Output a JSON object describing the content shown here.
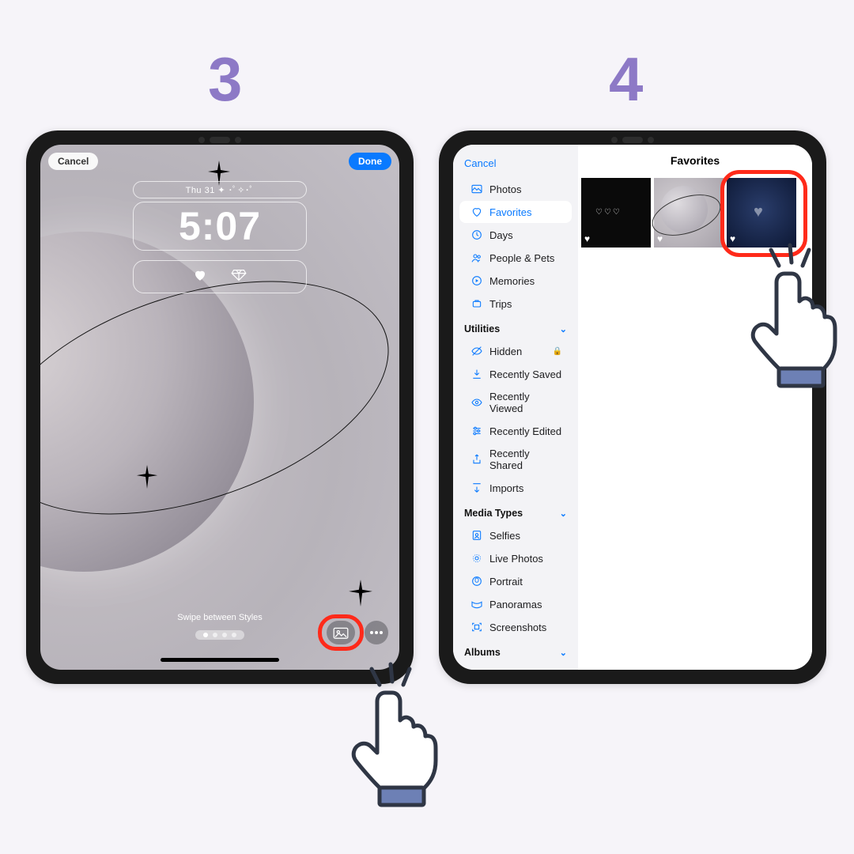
{
  "steps": {
    "s3": "3",
    "s4": "4"
  },
  "lock": {
    "cancel": "Cancel",
    "done": "Done",
    "date": "Thu 31  ✦ ･ﾟ✧･ﾟ",
    "time": "5:07",
    "swipe": "Swipe between Styles"
  },
  "picker": {
    "cancel": "Cancel",
    "title": "Favorites",
    "sections": {
      "utilities": "Utilities",
      "media": "Media Types",
      "albums": "Albums"
    },
    "items": {
      "photos": "Photos",
      "favorites": "Favorites",
      "days": "Days",
      "people": "People & Pets",
      "memories": "Memories",
      "trips": "Trips",
      "hidden": "Hidden",
      "rsaved": "Recently Saved",
      "rviewed": "Recently Viewed",
      "redited": "Recently Edited",
      "rshared": "Recently Shared",
      "imports": "Imports",
      "selfies": "Selfies",
      "live": "Live Photos",
      "portrait": "Portrait",
      "panoramas": "Panoramas",
      "screenshots": "Screenshots"
    }
  }
}
